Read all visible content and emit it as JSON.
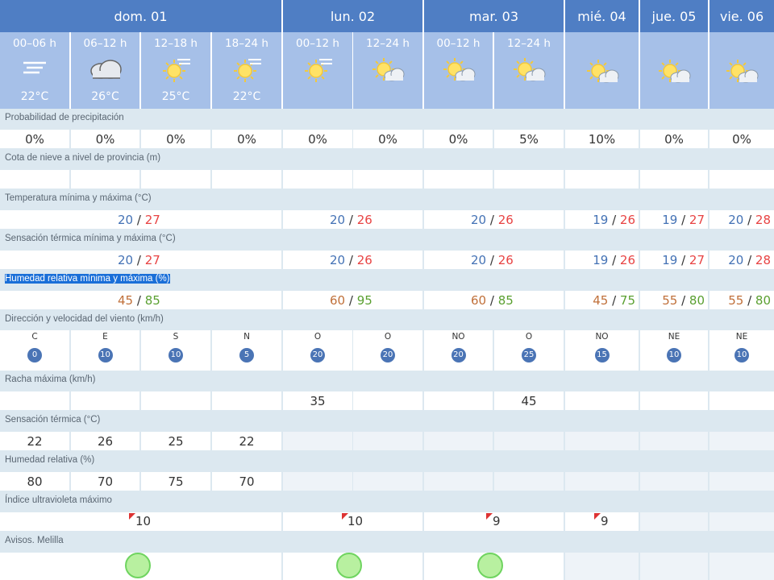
{
  "days": [
    {
      "label": "dom. 01"
    },
    {
      "label": "lun. 02"
    },
    {
      "label": "mar. 03"
    },
    {
      "label": "mié. 04"
    },
    {
      "label": "jue. 05"
    },
    {
      "label": "vie. 06"
    }
  ],
  "periods": [
    {
      "label": "00–06 h",
      "temp": "22°C",
      "icon": "mist-icon"
    },
    {
      "label": "06–12 h",
      "temp": "26°C",
      "icon": "cloud-icon"
    },
    {
      "label": "12–18 h",
      "temp": "25°C",
      "icon": "sun-haze-icon"
    },
    {
      "label": "18–24 h",
      "temp": "22°C",
      "icon": "sun-haze-icon"
    },
    {
      "label": "00–12 h",
      "temp": "",
      "icon": "sun-haze-icon"
    },
    {
      "label": "12–24 h",
      "temp": "",
      "icon": "sun-cloud-icon"
    },
    {
      "label": "00–12 h",
      "temp": "",
      "icon": "sun-cloud-icon"
    },
    {
      "label": "12–24 h",
      "temp": "",
      "icon": "sun-cloud-icon"
    },
    {
      "label": "",
      "temp": "",
      "icon": "sun-cloud-icon"
    },
    {
      "label": "",
      "temp": "",
      "icon": "sun-cloud-icon"
    },
    {
      "label": "",
      "temp": "",
      "icon": "sun-cloud-icon"
    }
  ],
  "labels": {
    "precip": "Probabilidad de precipitación",
    "snow": "Cota de nieve a nivel de provincia (m)",
    "temp": "Temperatura mínima y máxima (°C)",
    "feels": "Sensación térmica mínima y máxima (°C)",
    "humidity": "Humedad relativa mínima y máxima (%)",
    "wind": "Dirección y velocidad del viento (km/h)",
    "gust": "Racha máxima (km/h)",
    "feels_now": "Sensación térmica (°C)",
    "hum_now": "Humedad relativa (%)",
    "uv": "Índice ultravioleta máximo",
    "warnings": "Avisos. Melilla"
  },
  "precip": [
    "0%",
    "0%",
    "0%",
    "0%",
    "0%",
    "0%",
    "0%",
    "5%",
    "10%",
    "0%",
    "0%"
  ],
  "temp_minmax": [
    {
      "min": "20",
      "max": "27"
    },
    {
      "min": "20",
      "max": "26"
    },
    {
      "min": "20",
      "max": "26"
    },
    {
      "min": "19",
      "max": "26"
    },
    {
      "min": "19",
      "max": "27"
    },
    {
      "min": "20",
      "max": "28"
    }
  ],
  "feels_minmax": [
    {
      "min": "20",
      "max": "27"
    },
    {
      "min": "20",
      "max": "26"
    },
    {
      "min": "20",
      "max": "26"
    },
    {
      "min": "19",
      "max": "26"
    },
    {
      "min": "19",
      "max": "27"
    },
    {
      "min": "20",
      "max": "28"
    }
  ],
  "hum_minmax": [
    {
      "min": "45",
      "max": "85"
    },
    {
      "min": "60",
      "max": "95"
    },
    {
      "min": "60",
      "max": "85"
    },
    {
      "min": "45",
      "max": "75"
    },
    {
      "min": "55",
      "max": "80"
    },
    {
      "min": "55",
      "max": "80"
    }
  ],
  "slash": "/",
  "wind": [
    {
      "dir": "C",
      "speed": "0"
    },
    {
      "dir": "E",
      "speed": "10"
    },
    {
      "dir": "S",
      "speed": "10"
    },
    {
      "dir": "N",
      "speed": "5"
    },
    {
      "dir": "O",
      "speed": "20"
    },
    {
      "dir": "O",
      "speed": "20"
    },
    {
      "dir": "NO",
      "speed": "20"
    },
    {
      "dir": "O",
      "speed": "25"
    },
    {
      "dir": "NO",
      "speed": "15"
    },
    {
      "dir": "NE",
      "speed": "10"
    },
    {
      "dir": "NE",
      "speed": "10"
    }
  ],
  "gust": [
    "",
    "",
    "",
    "",
    "35",
    "",
    "",
    "45",
    "",
    "",
    ""
  ],
  "feels_now": [
    "22",
    "26",
    "25",
    "22"
  ],
  "hum_now": [
    "80",
    "70",
    "75",
    "70"
  ],
  "uv": [
    "10",
    "10",
    "9",
    "9"
  ],
  "colors": {
    "header": "#4f7ec4",
    "period": "#a6c0e8",
    "label_row": "#dce8f0",
    "min": "#4472b5",
    "max": "#e84343"
  }
}
